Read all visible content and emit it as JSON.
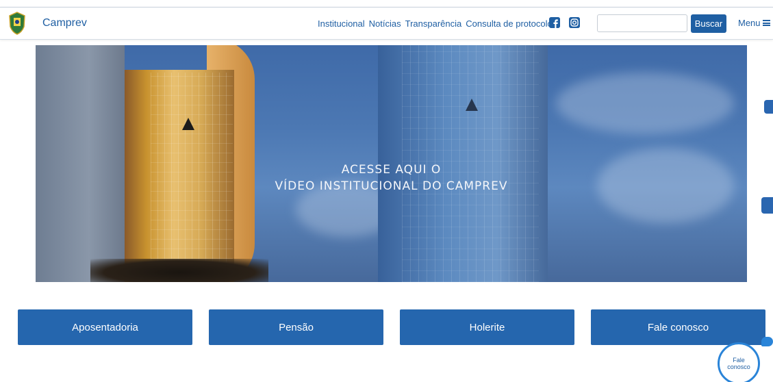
{
  "header": {
    "brand": "Camprev",
    "nav": [
      "Institucional",
      "Notícias",
      "Transparência",
      "Consulta de protocolo"
    ],
    "search_placeholder": "",
    "search_button": "Buscar",
    "menu_label": "Menu"
  },
  "hero": {
    "line1": "ACESSE AQUI O",
    "line2": "VÍDEO INSTITUCIONAL DO CAMPREV"
  },
  "cards": [
    "Aposentadoria",
    "Pensão",
    "Holerite",
    "Fale conosco"
  ],
  "chat": {
    "label_line1": "Fale",
    "label_line2": "conosco"
  },
  "colors": {
    "primary": "#2566ae",
    "accent": "#2a84d8"
  },
  "icons": [
    "facebook-icon",
    "instagram-icon",
    "menu-icon",
    "accessibility-icon",
    "sign-language-icon",
    "chat-icon"
  ]
}
